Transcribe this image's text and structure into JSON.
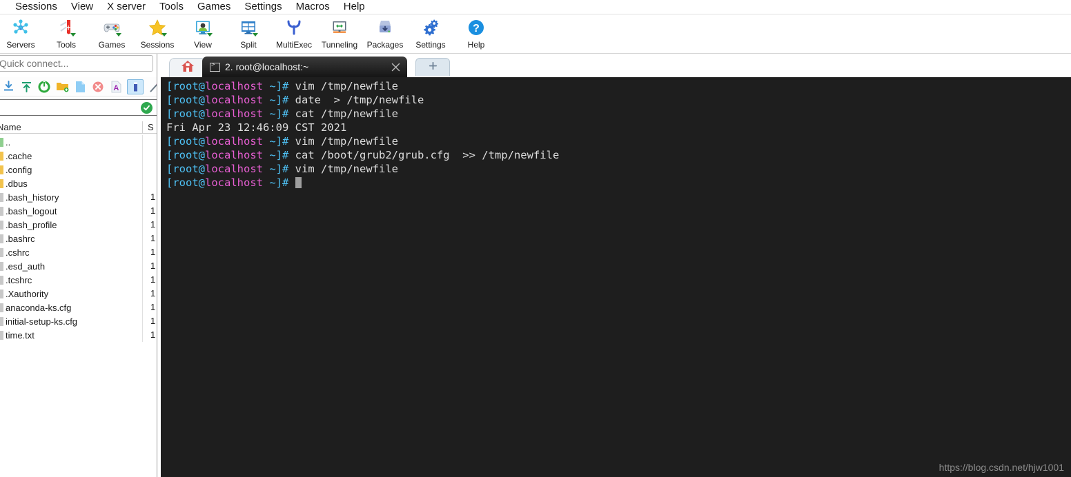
{
  "menubar": {
    "items": [
      {
        "label": "Sessions"
      },
      {
        "label": "View"
      },
      {
        "label": "X server"
      },
      {
        "label": "Tools"
      },
      {
        "label": "Games"
      },
      {
        "label": "Settings"
      },
      {
        "label": "Macros"
      },
      {
        "label": "Help"
      }
    ]
  },
  "toolbar": {
    "buttons": [
      {
        "label": "Servers",
        "icon": "servers-icon",
        "dropdown": false
      },
      {
        "label": "Tools",
        "icon": "tools-icon",
        "dropdown": true
      },
      {
        "label": "Games",
        "icon": "games-icon",
        "dropdown": true
      },
      {
        "label": "Sessions",
        "icon": "star-icon",
        "dropdown": true
      },
      {
        "label": "View",
        "icon": "monitor-user-icon",
        "dropdown": true
      },
      {
        "label": "Split",
        "icon": "split-screen-icon",
        "dropdown": true
      },
      {
        "label": "MultiExec",
        "icon": "multiexec-icon",
        "dropdown": false
      },
      {
        "label": "Tunneling",
        "icon": "tunneling-icon",
        "dropdown": false
      },
      {
        "label": "Packages",
        "icon": "packages-icon",
        "dropdown": false
      },
      {
        "label": "Settings",
        "icon": "gear-icon",
        "dropdown": false
      },
      {
        "label": "Help",
        "icon": "help-icon",
        "dropdown": false
      }
    ]
  },
  "sidebar": {
    "quick_connect": {
      "placeholder": "Quick connect...",
      "value": ""
    },
    "tools": [
      {
        "name": "download-icon",
        "selected": false
      },
      {
        "name": "upload-icon",
        "selected": false
      },
      {
        "name": "refresh-icon",
        "selected": false
      },
      {
        "name": "new-folder-icon",
        "selected": false
      },
      {
        "name": "new-file-icon",
        "selected": false
      },
      {
        "name": "delete-icon",
        "selected": false
      },
      {
        "name": "rename-icon",
        "selected": false
      },
      {
        "name": "edit-file-icon",
        "selected": true
      },
      {
        "name": "magic-wand-icon",
        "selected": false
      }
    ],
    "filter": {
      "value": "",
      "status": "ok"
    },
    "columns": {
      "name": "Name",
      "size": "S"
    },
    "files": [
      {
        "name": "..",
        "type": "dirup",
        "size": ""
      },
      {
        "name": ".cache",
        "type": "dir",
        "size": ""
      },
      {
        "name": ".config",
        "type": "dir",
        "size": ""
      },
      {
        "name": ".dbus",
        "type": "dir",
        "size": ""
      },
      {
        "name": ".bash_history",
        "type": "file",
        "size": "1"
      },
      {
        "name": ".bash_logout",
        "type": "file",
        "size": "1"
      },
      {
        "name": ".bash_profile",
        "type": "file",
        "size": "1"
      },
      {
        "name": ".bashrc",
        "type": "file",
        "size": "1"
      },
      {
        "name": ".cshrc",
        "type": "file",
        "size": "1"
      },
      {
        "name": ".esd_auth",
        "type": "file",
        "size": "1"
      },
      {
        "name": ".tcshrc",
        "type": "file",
        "size": "1"
      },
      {
        "name": ".Xauthority",
        "type": "file",
        "size": "1"
      },
      {
        "name": "anaconda-ks.cfg",
        "type": "file",
        "size": "1"
      },
      {
        "name": "initial-setup-ks.cfg",
        "type": "file",
        "size": "1"
      },
      {
        "name": "time.txt",
        "type": "file",
        "size": "1"
      }
    ]
  },
  "tabs": {
    "home_icon": "home-icon",
    "terminal_tab_label": "2. root@localhost:~",
    "close_label": "×",
    "new_tab_label": "✚"
  },
  "terminal": {
    "colors": {
      "background": "#1e1e1e",
      "prompt_bracket": "#4fc3f7",
      "prompt_host": "#e85fd4",
      "text": "#dcdcdc"
    },
    "lines": [
      {
        "prompt": true,
        "command": "vim /tmp/newfile"
      },
      {
        "prompt": true,
        "command": "date  > /tmp/newfile"
      },
      {
        "prompt": true,
        "command": "cat /tmp/newfile"
      },
      {
        "prompt": false,
        "command": "Fri Apr 23 12:46:09 CST 2021"
      },
      {
        "prompt": true,
        "command": "vim /tmp/newfile"
      },
      {
        "prompt": true,
        "command": "cat /boot/grub2/grub.cfg  >> /tmp/newfile"
      },
      {
        "prompt": true,
        "command": "vim /tmp/newfile"
      },
      {
        "prompt": true,
        "command": "",
        "cursor": true
      }
    ],
    "prompt_parts": {
      "open": "[root@",
      "host": "localhost",
      "close": " ~]# "
    }
  },
  "watermark": "https://blog.csdn.net/hjw1001"
}
